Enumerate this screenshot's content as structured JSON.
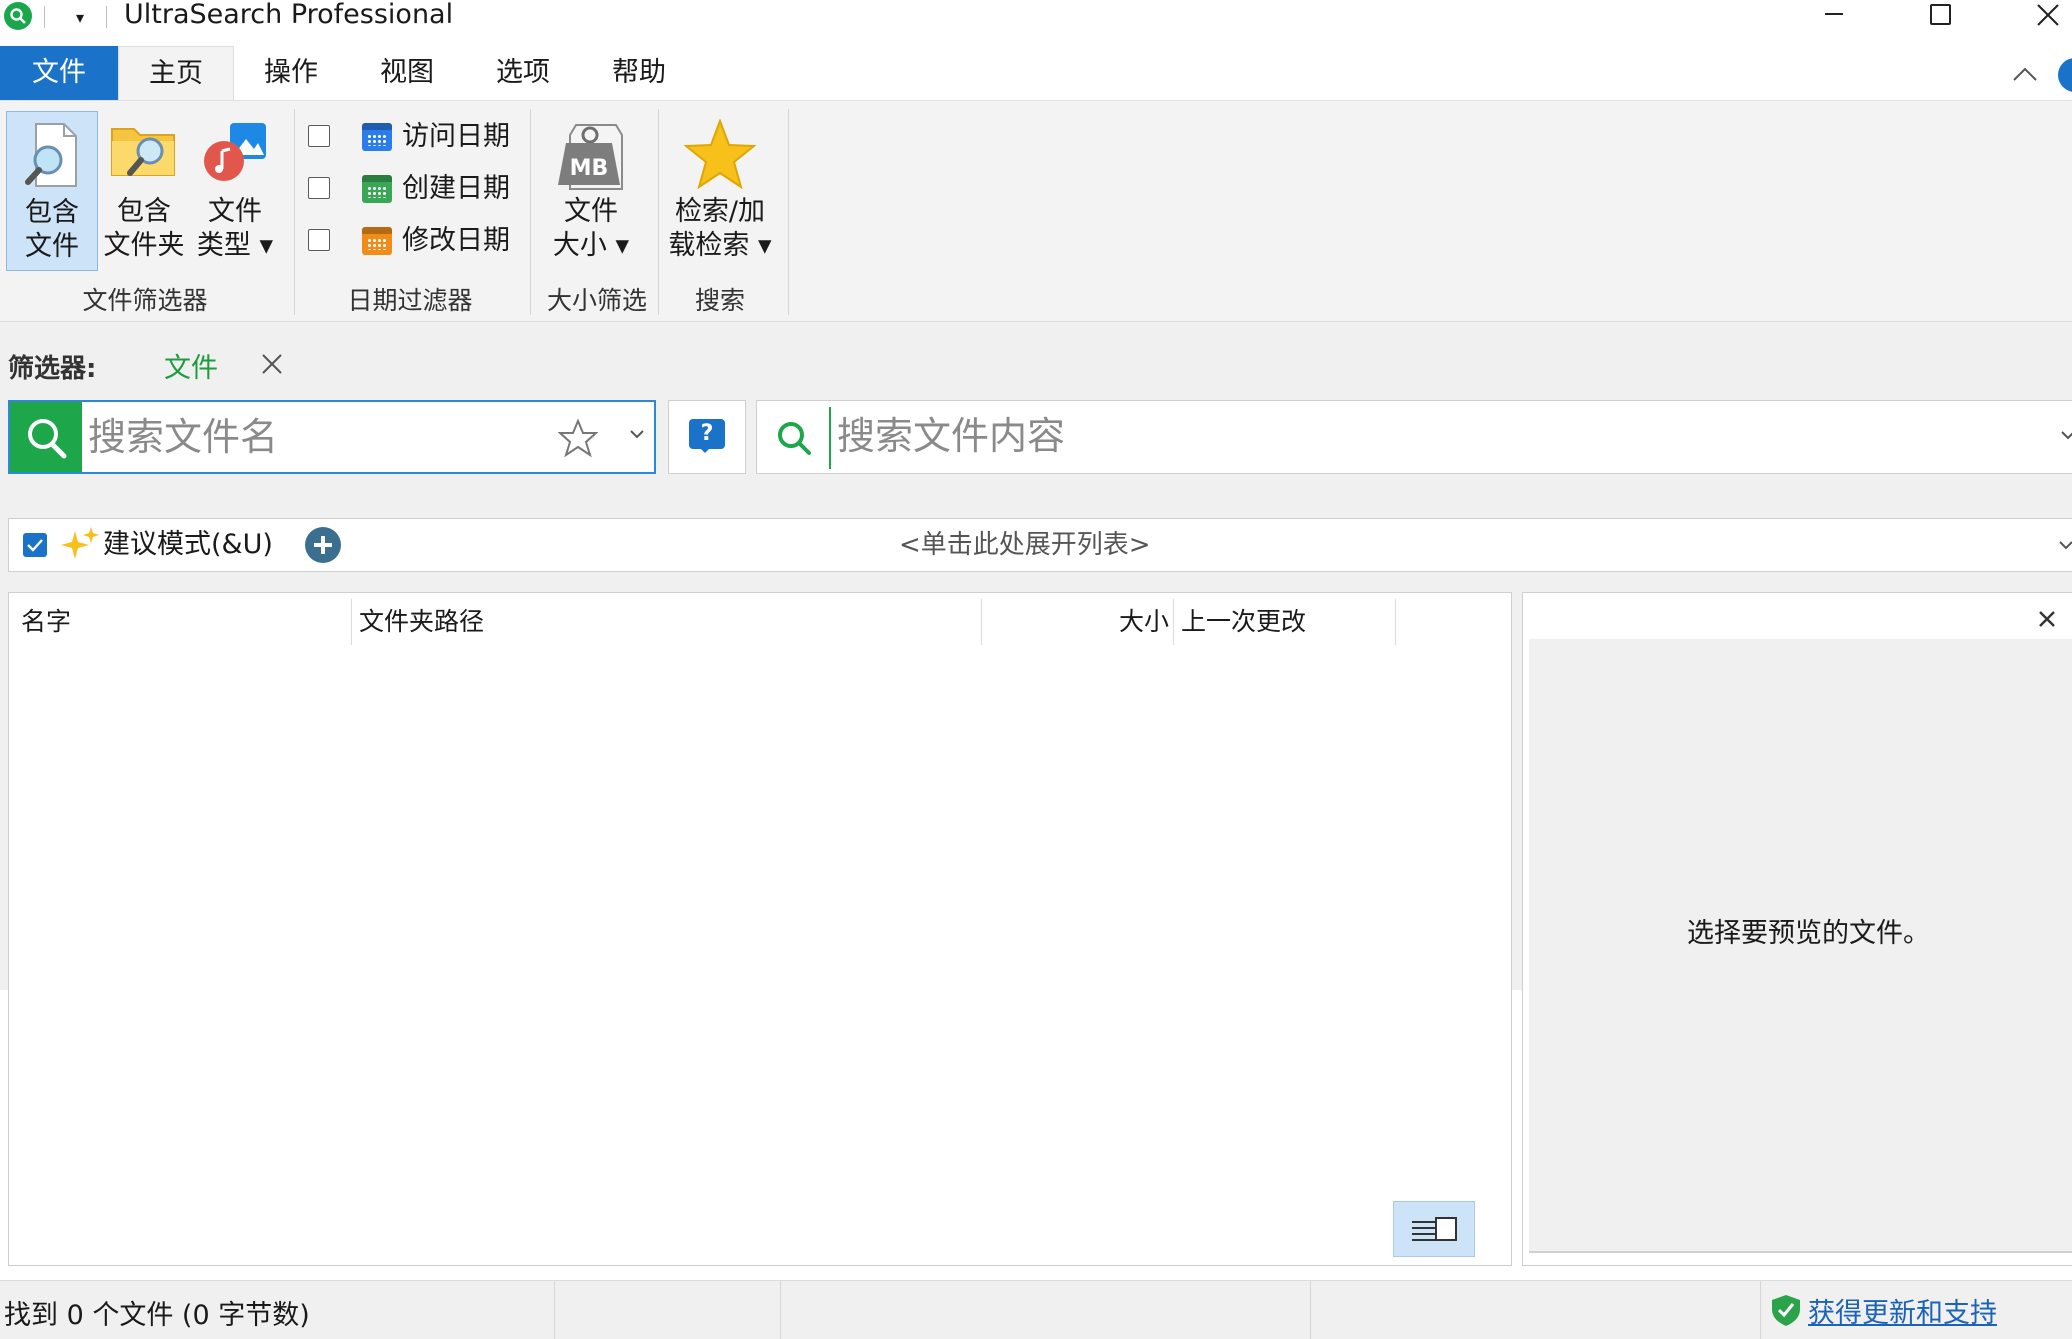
{
  "window": {
    "title": "UltraSearch Professional",
    "qat_dropdown": "▾"
  },
  "ribbon": {
    "tabs": [
      "文件",
      "主页",
      "操作",
      "视图",
      "选项",
      "帮助"
    ],
    "active_tab": "主页",
    "groups": {
      "file_filter": {
        "label": "文件筛选器",
        "include_files": [
          "包含",
          "文件"
        ],
        "include_folders": [
          "包含",
          "文件夹"
        ],
        "file_types": [
          "文件",
          "类型 ▾"
        ]
      },
      "date_filter": {
        "label": "日期过滤器",
        "rows": [
          "访问日期",
          "创建日期",
          "修改日期"
        ],
        "checked": [
          false,
          false,
          false
        ]
      },
      "size_filter": {
        "label": "大小筛选",
        "file_size": [
          "文件",
          "大小 ▾"
        ],
        "icon_text": "MB"
      },
      "search": {
        "label": "搜索",
        "search_load": [
          "检索/加",
          "载检索 ▾"
        ]
      }
    }
  },
  "filter": {
    "label": "筛选器:",
    "chip": "文件"
  },
  "search": {
    "name_placeholder": "搜索文件名",
    "help_icon_text": "?",
    "content_placeholder": "搜索文件内容"
  },
  "suggest": {
    "checked": true,
    "label": "建议模式(&U)",
    "expand_text": "<单击此处展开列表>"
  },
  "results": {
    "columns": [
      "名字",
      "文件夹路径",
      "大小",
      "上一次更改"
    ],
    "rows": []
  },
  "preview": {
    "message": "选择要预览的文件。"
  },
  "status": {
    "found_text": "找到 0 个文件 (0 字节数)",
    "update_link": "获得更新和支持"
  },
  "colors": {
    "accent_blue": "#1a73c9",
    "search_green": "#1ea64a",
    "filter_chip_green": "#1e9b3c",
    "selected_button_bg": "#cde3f7"
  }
}
